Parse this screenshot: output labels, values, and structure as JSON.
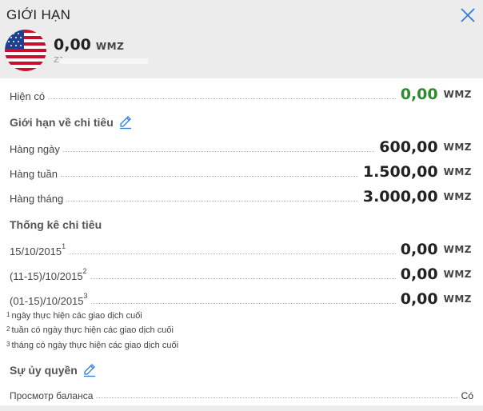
{
  "header": {
    "title": "GIỚI HẠN",
    "amount": "0,00",
    "currency": "WMZ",
    "purse_partial": "Z1"
  },
  "available": {
    "label": "Hiện có",
    "value": "0,00",
    "currency": "WMZ",
    "color": "#2e8b2e"
  },
  "limits": {
    "title": "Giới hạn về chi tiêu",
    "rows": [
      {
        "label": "Hàng ngày",
        "value": "600,00",
        "currency": "WMZ"
      },
      {
        "label": "Hàng tuần",
        "value": "1.500,00",
        "currency": "WMZ"
      },
      {
        "label": "Hàng tháng",
        "value": "3.000,00",
        "currency": "WMZ"
      }
    ]
  },
  "stats": {
    "title": "Thống kê chi tiêu",
    "rows": [
      {
        "label": "15/10/2015",
        "sup": "1",
        "value": "0,00",
        "currency": "WMZ"
      },
      {
        "label": "(11-15)/10/2015",
        "sup": "2",
        "value": "0,00",
        "currency": "WMZ"
      },
      {
        "label": "(01-15)/10/2015",
        "sup": "3",
        "value": "0,00",
        "currency": "WMZ"
      }
    ],
    "notes": [
      {
        "sup": "1",
        "text": "ngày thực hiện các giao dịch cuối"
      },
      {
        "sup": "2",
        "text": "tuần có ngày thực hiện các giao dịch cuối"
      },
      {
        "sup": "3",
        "text": "tháng có ngày thực hiện các giao dịch cuối"
      }
    ]
  },
  "authorization": {
    "title": "Sự ủy quyền",
    "rows": [
      {
        "label": "Просмотр баланса",
        "value": "Có"
      }
    ]
  },
  "colors": {
    "header_bg": "#ececec",
    "accent": "#2a7fd4",
    "positive": "#2e8b2e"
  }
}
